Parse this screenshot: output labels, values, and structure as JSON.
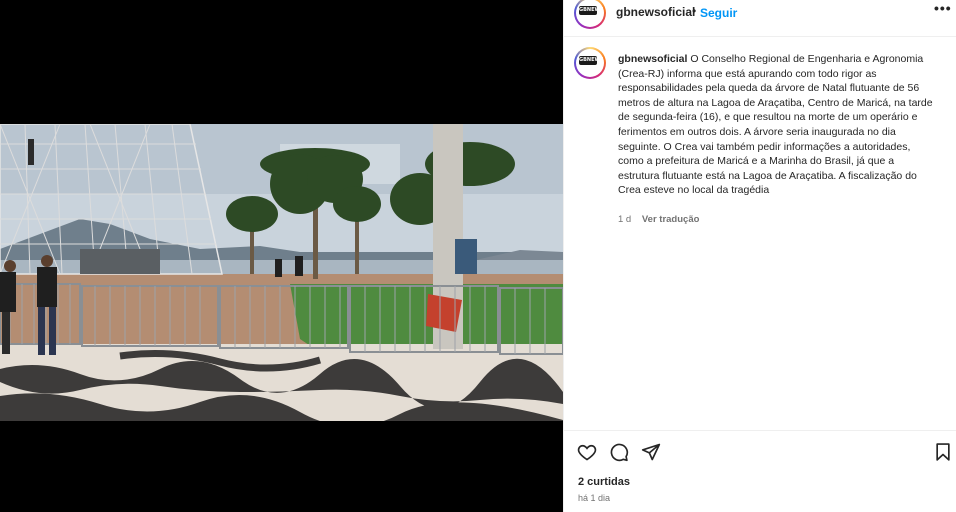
{
  "post": {
    "username": "gbnewsoficial",
    "follow_label": "Seguir",
    "avatar_text": "GBNEWS"
  },
  "caption": {
    "username": "gbnewsoficial",
    "text": "O Conselho Regional de Engenharia e Agronomia (Crea-RJ) informa que está apurando com todo rigor as responsabilidades pela queda da árvore de Natal flutuante de 56 metros de altura na Lagoa de Araçatiba, Centro de Maricá, na tarde de segunda-feira (16), e que resultou na morte de um operário e ferimentos em outros dois. A árvore seria inaugurada no dia seguinte. O Crea vai também pedir informações a autoridades, como a prefeitura de Maricá e a Marinha do Brasil, já que a estrutura flutuante está na Lagoa de Araçatiba. A fiscalização do Crea esteve no local da tragédia",
    "age": "1 d",
    "translate_label": "Ver tradução"
  },
  "footer": {
    "likes": "2 curtidas",
    "time": "há 1 dia"
  },
  "icons": {
    "like": "heart-icon",
    "comment": "comment-icon",
    "share": "paper-plane-icon",
    "save": "bookmark-icon",
    "more": "more-icon"
  },
  "colors": {
    "link": "#0095f6",
    "text": "#262626",
    "muted": "#737373"
  }
}
